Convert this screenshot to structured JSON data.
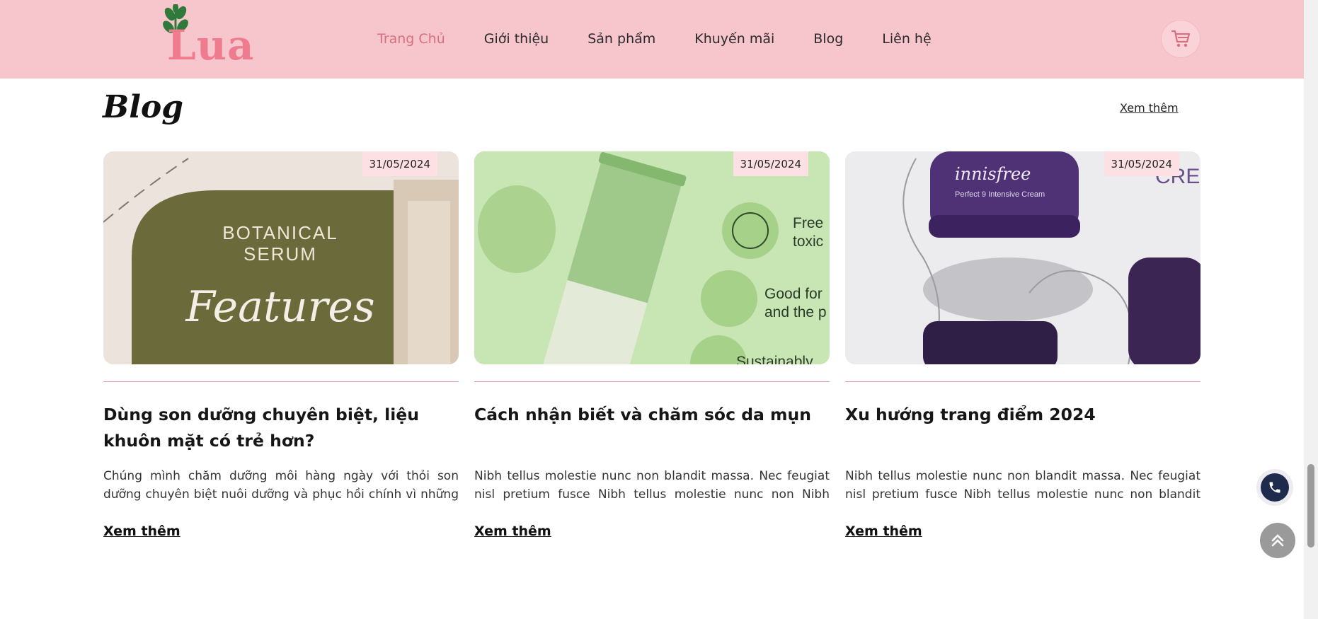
{
  "header": {
    "logo_text": "Lua",
    "nav": [
      {
        "label": "Trang Chủ",
        "active": true
      },
      {
        "label": "Giới thiệu"
      },
      {
        "label": "Sản phẩm"
      },
      {
        "label": "Khuyến mãi"
      },
      {
        "label": "Blog"
      },
      {
        "label": "Liên hệ"
      }
    ],
    "cart_icon": "cart-icon"
  },
  "blog": {
    "title": "Blog",
    "see_all": "Xem thêm",
    "posts": [
      {
        "date": "31/05/2024",
        "image_text": [
          "BOTANICAL",
          "SERUM",
          "Features"
        ],
        "title": "Dùng son dưỡng chuyên biệt, liệu khuôn mặt có trẻ hơn?",
        "excerpt": "Chúng mình chăm dưỡng môi hàng ngày với thỏi son dưỡng chuyên biệt nuôi dưỡng và phục hồi chính vì những kết q...",
        "more": "Xem thêm"
      },
      {
        "date": "31/05/2024",
        "image_text": [
          "Free",
          "toxic",
          "Good for",
          "and the p",
          "Sustainably"
        ],
        "title": "Cách nhận biết và chăm sóc da mụn",
        "excerpt": "Nibh tellus molestie nunc non blandit massa. Nec feugiat nisl pretium fusce Nibh tellus molestie nunc non Nibh tell...",
        "more": "Xem thêm"
      },
      {
        "date": "31/05/2024",
        "image_text": [
          "innisfree",
          "Perfect 9 Intensive Cream",
          "CRE"
        ],
        "title": "Xu hướng trang điểm 2024",
        "excerpt": "Nibh tellus molestie nunc non blandit massa. Nec feugiat nisl pretium fusce Nibh tellus molestie nunc non blandit mass...",
        "more": "Xem thêm"
      }
    ]
  },
  "floating": {
    "phone_icon": "phone-icon",
    "back_to_top_icon": "double-chevron-up-icon"
  },
  "colors": {
    "header_bg": "#f7c6cd",
    "accent": "#d6707f",
    "logo": "#ef7c8e",
    "date_badge": "#fde0e4"
  }
}
